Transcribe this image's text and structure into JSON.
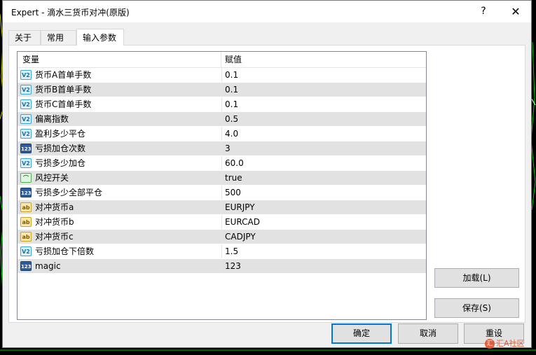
{
  "window": {
    "title": "Expert - 滴水三货币对冲(原版)",
    "help_label": "?",
    "close_label": "✕"
  },
  "tabs": [
    {
      "label": "关于",
      "active": false
    },
    {
      "label": "常用",
      "active": false
    },
    {
      "label": "输入参数",
      "active": true
    }
  ],
  "table": {
    "headers": {
      "variable": "变量",
      "value": "赋值"
    },
    "rows": [
      {
        "type": "double",
        "icon_text": "V2",
        "name": "货币A首单手数",
        "value": "0.1"
      },
      {
        "type": "double",
        "icon_text": "V2",
        "name": "货币B首单手数",
        "value": "0.1"
      },
      {
        "type": "double",
        "icon_text": "V2",
        "name": "货币C首单手数",
        "value": "0.1"
      },
      {
        "type": "double",
        "icon_text": "V2",
        "name": "偏离指数",
        "value": "0.5"
      },
      {
        "type": "double",
        "icon_text": "V2",
        "name": "盈利多少平仓",
        "value": "4.0"
      },
      {
        "type": "int",
        "icon_text": "123",
        "name": "亏损加仓次数",
        "value": "3"
      },
      {
        "type": "double",
        "icon_text": "V2",
        "name": "亏损多少加仓",
        "value": "60.0"
      },
      {
        "type": "bool",
        "icon_text": "⌒",
        "name": "风控开关",
        "value": "true"
      },
      {
        "type": "int",
        "icon_text": "123",
        "name": "亏损多少全部平仓",
        "value": "500"
      },
      {
        "type": "string",
        "icon_text": "ab",
        "name": "对冲货币a",
        "value": "EURJPY"
      },
      {
        "type": "string",
        "icon_text": "ab",
        "name": "对冲货币b",
        "value": "EURCAD"
      },
      {
        "type": "string",
        "icon_text": "ab",
        "name": "对冲货币c",
        "value": "CADJPY"
      },
      {
        "type": "double",
        "icon_text": "V2",
        "name": "亏损加仓下倍数",
        "value": "1.5"
      },
      {
        "type": "int",
        "icon_text": "123",
        "name": "magic",
        "value": "123"
      }
    ]
  },
  "buttons": {
    "load": "加载(L)",
    "save": "保存(S)",
    "ok": "确定",
    "cancel": "取消",
    "reset": "重设"
  },
  "watermark": {
    "logo": "汇",
    "text": "汇A社区"
  },
  "colors": {
    "accent": "#0078d7",
    "row_alt": "#e2e2e2",
    "background": "#000000",
    "dialog": "#f0f0f0"
  }
}
